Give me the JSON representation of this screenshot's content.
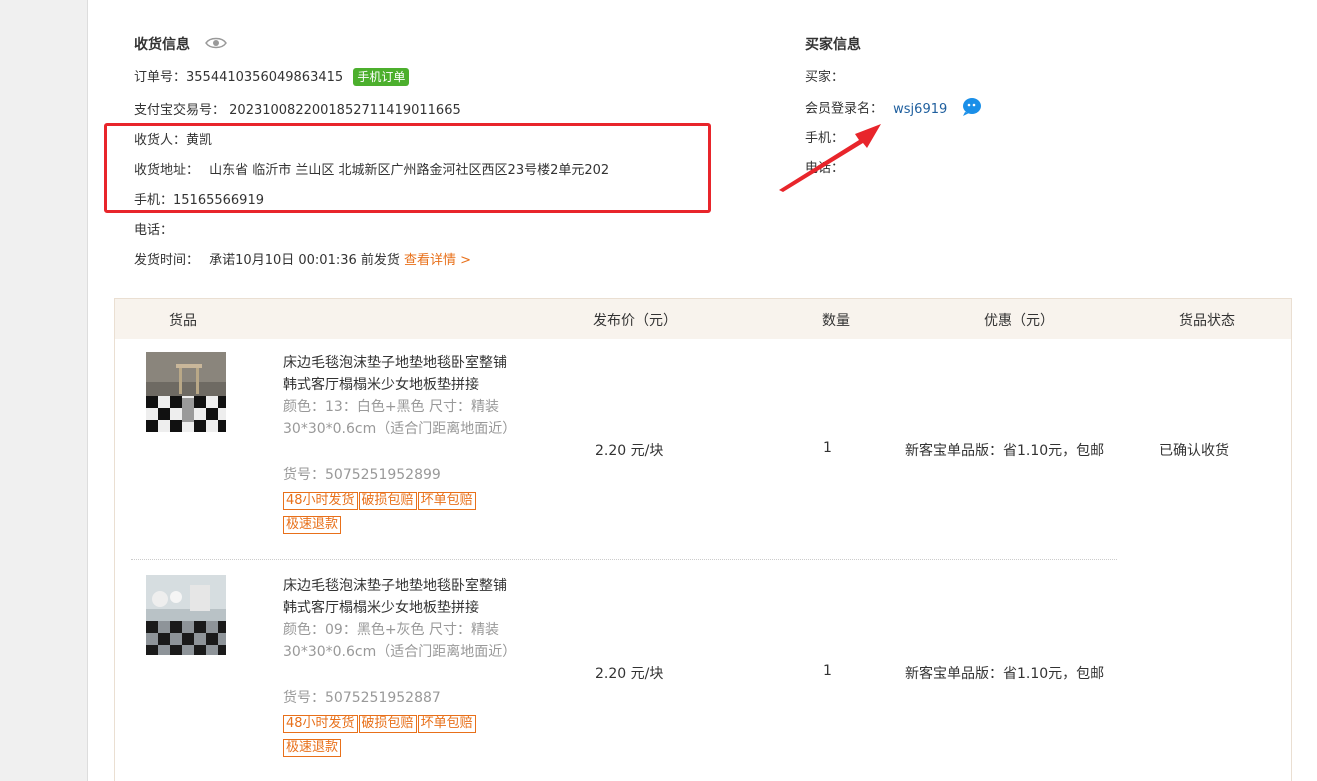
{
  "receiver": {
    "section_title": "收货信息",
    "order_no_label": "订单号：",
    "order_no": "3554410356049863415",
    "mobile_order_badge": "手机订单",
    "alipay_label": "支付宝交易号：",
    "alipay_no": "2023100822001852711419011665",
    "name_label": "收货人：",
    "name": "黄凯",
    "address_label": "收货地址：",
    "address": "山东省 临沂市 兰山区 北城新区广州路金河社区西区23号楼2单元202",
    "phone_label": "手机：",
    "phone": "15165566919",
    "tel_label": "电话：",
    "ship_time_label": "发货时间：",
    "ship_time": "承诺10月10日 00:01:36 前发货",
    "details_link": "查看详情 >"
  },
  "buyer": {
    "section_title": "买家信息",
    "buyer_label": "买家：",
    "member_label": "会员登录名：",
    "member_id": "wsj6919",
    "phone_label": "手机：",
    "tel_label": "电话："
  },
  "table": {
    "headers": {
      "goods": "货品",
      "price": "发布价（元）",
      "qty": "数量",
      "discount": "优惠（元）",
      "status": "货品状态"
    },
    "rows": [
      {
        "name": "床边毛毯泡沫垫子地垫地毯卧室整铺韩式客厅榻榻米少女地板垫拼接",
        "sku": "颜色：13：白色+黑色   尺寸：精装30*30*0.6cm（适合门距离地面近）",
        "code": "货号：5075251952899",
        "tags": [
          "48小时发货",
          "破损包赔",
          "坏单包赔",
          "极速退款"
        ],
        "price": "2.20 元/块",
        "qty": "1",
        "discount": "新客宝单品版：省1.10元，包邮",
        "status": "已确认收货"
      },
      {
        "name": "床边毛毯泡沫垫子地垫地毯卧室整铺韩式客厅榻榻米少女地板垫拼接",
        "sku": "颜色：09：黑色+灰色   尺寸：精装30*30*0.6cm（适合门距离地面近）",
        "code": "货号：5075251952887",
        "tags": [
          "48小时发货",
          "破损包赔",
          "坏单包赔",
          "极速退款"
        ],
        "price": "2.20 元/块",
        "qty": "1",
        "discount": "新客宝单品版：省1.10元，包邮",
        "status": ""
      }
    ]
  },
  "colors": {
    "highlight": "#e8252b",
    "accent_orange": "#e8701a",
    "link_blue": "#1f5f9e",
    "badge_green": "#4caf2d",
    "table_header_bg": "#f8f3ed"
  },
  "icons": {
    "eye": "eye-icon",
    "qq": "qq-chat-icon",
    "arrow": "red-arrow-annotation"
  }
}
